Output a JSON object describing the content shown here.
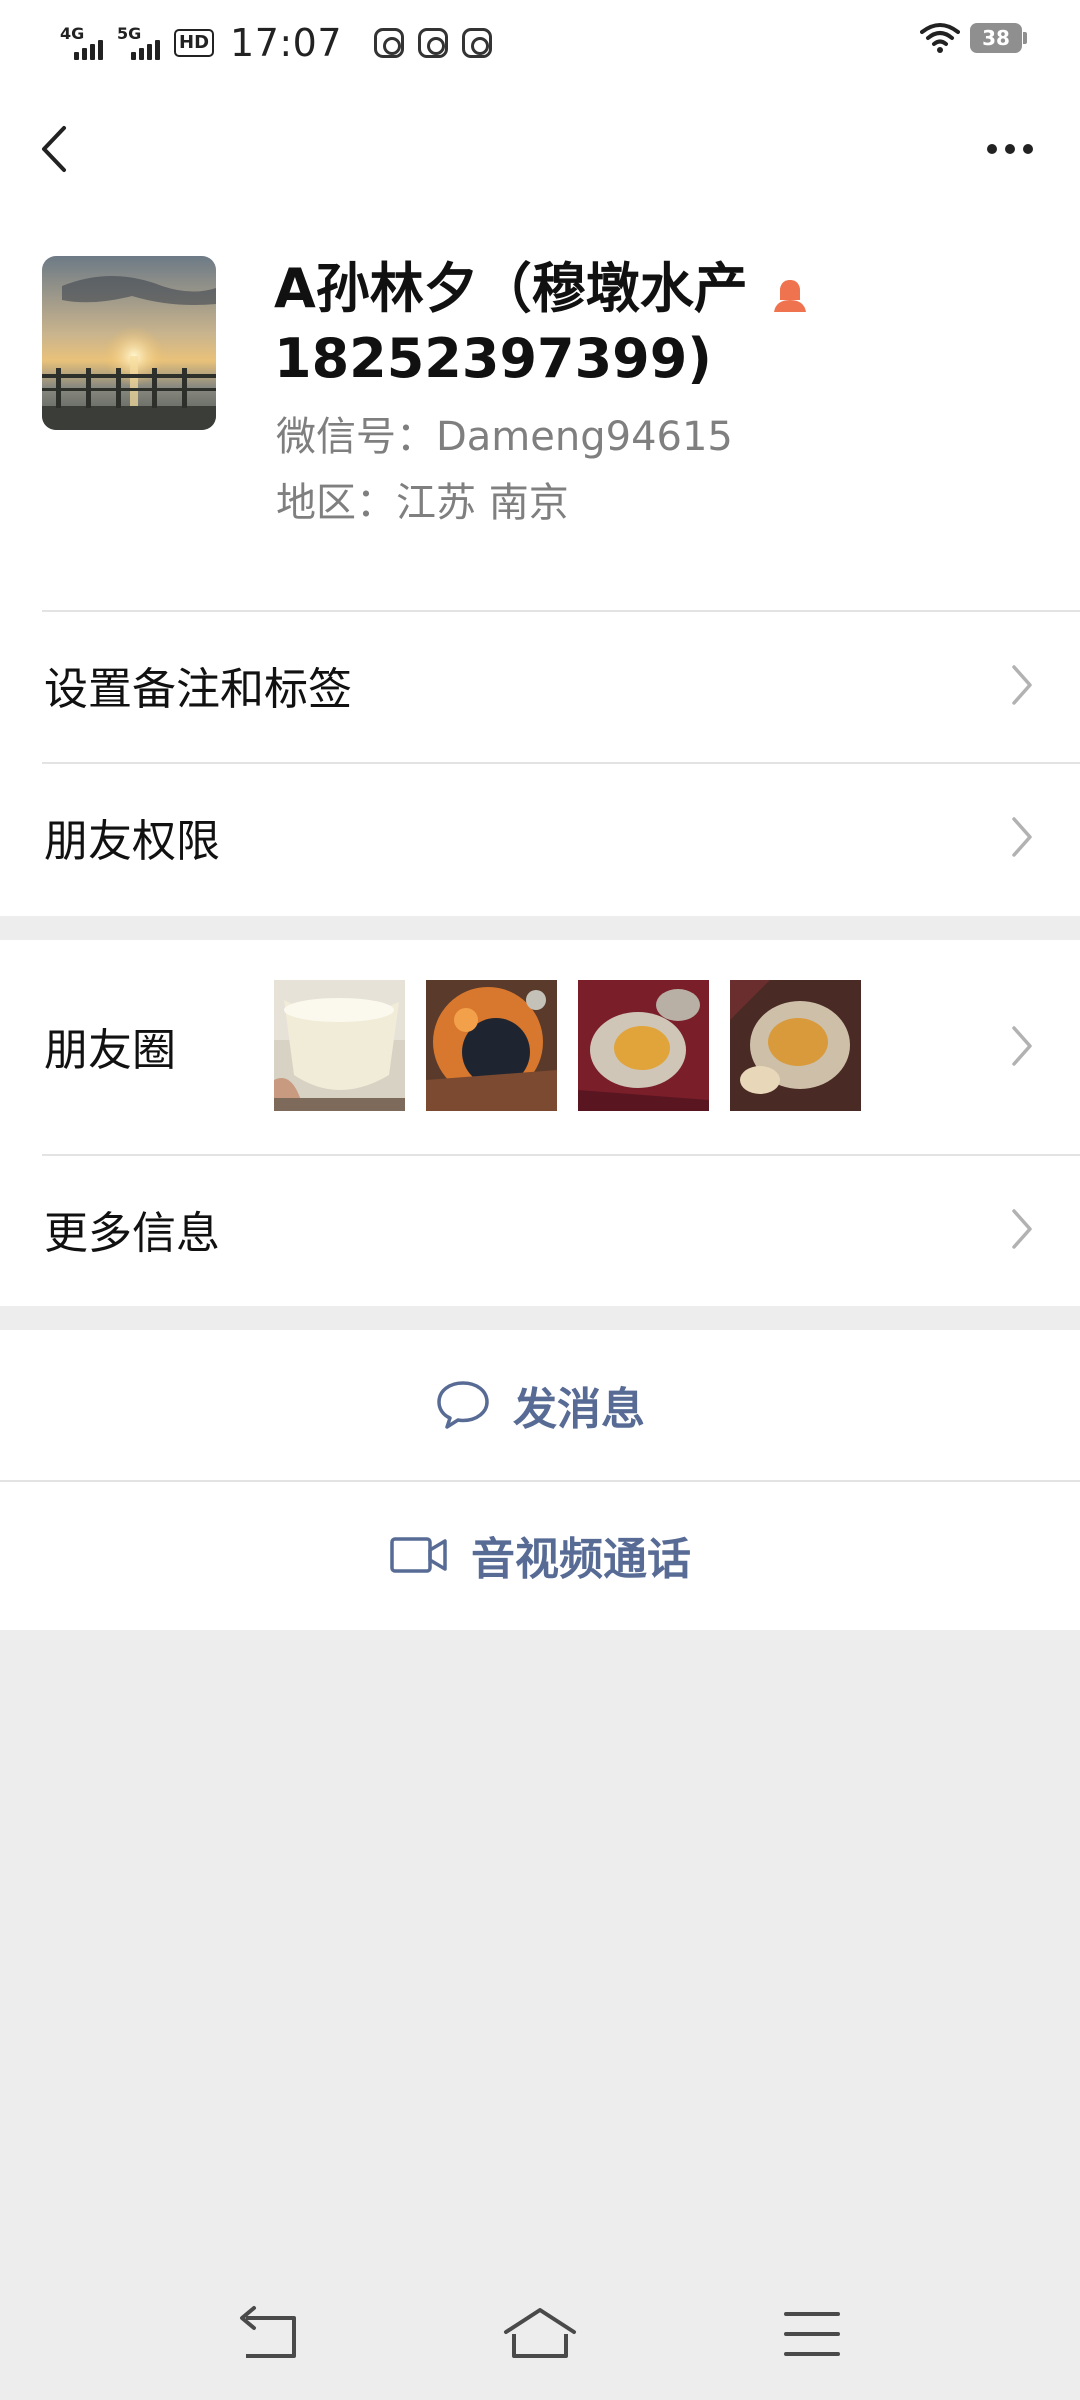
{
  "status_bar": {
    "net1": "4G",
    "net2": "5G",
    "hd_label": "HD",
    "time": "17:07",
    "battery": "38",
    "notification_icons": [
      "scissors-icon",
      "hand-icon",
      "link-icon"
    ]
  },
  "header": {
    "back_icon": "chevron-left-icon",
    "more_icon": "more-dots-icon"
  },
  "profile": {
    "name": "A孙林夕（穆墩水产18252397399)",
    "gender_icon": "female-user-icon",
    "wechat_id": "微信号：Dameng94615",
    "region": "地区：江苏  南京"
  },
  "rows": {
    "remark_tags": "设置备注和标签",
    "friend_permissions": "朋友权限",
    "moments": "朋友圈",
    "more_info": "更多信息"
  },
  "actions": {
    "send_message": "发消息",
    "video_call": "音视频通话"
  },
  "colors": {
    "accent_link": "#576b95",
    "background": "#ededed",
    "gender_icon": "#f0734f"
  }
}
